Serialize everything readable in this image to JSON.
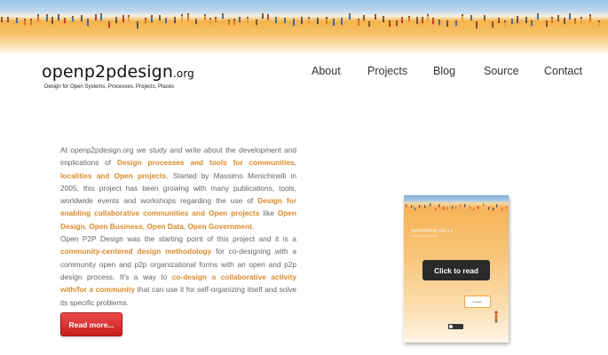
{
  "site": {
    "title": "openp2pdesign",
    "tld": ".org",
    "tagline": "Design for Open Systems, Processes, Projects, Places"
  },
  "nav": [
    {
      "label": "About"
    },
    {
      "label": "Projects"
    },
    {
      "label": "Blog"
    },
    {
      "label": "Source"
    },
    {
      "label": "Contact"
    }
  ],
  "intro": {
    "p1": [
      {
        "t": "At openp2pdesign.org we study and write about the development and implications of "
      },
      {
        "t": "Design processes and tools for communities, localities and Open projects",
        "hl": true
      },
      {
        "t": ". Started by Massimo Menichinelli in 2005, this project has been growing with many publications, tools, worldwide events and workshops regarding the use of "
      },
      {
        "t": "Design for enabling collaborative communities and Open projects",
        "hl": true
      },
      {
        "t": " like "
      },
      {
        "t": "Open Design",
        "hl": true
      },
      {
        "t": ", "
      },
      {
        "t": "Open Business",
        "hl": true
      },
      {
        "t": ", "
      },
      {
        "t": "Open Data",
        "hl": true
      },
      {
        "t": ", "
      },
      {
        "t": "Open Government",
        "hl": true
      },
      {
        "t": "."
      }
    ],
    "p2": [
      {
        "t": "Open P2P Design was the starting point of this project and it is a "
      },
      {
        "t": "community-centered design methodology",
        "hl": true
      },
      {
        "t": " for co-designing with a community open and p2p organizational forms with an open and p2p design process. It's a way to "
      },
      {
        "t": "co-design a collaborative activity with/for a community",
        "hl": true
      },
      {
        "t": " that can use it for self-organizing itself and solve its specific problems."
      }
    ]
  },
  "read_more_label": "Read more...",
  "book": {
    "title": "openp2pdesign.org_1.1",
    "subtitle": "Design for Complexity",
    "click_label": "Click to read",
    "callout_text": "A Paper"
  },
  "colors": {
    "accent": "#d98a2b",
    "button_red": "#d32a2a",
    "banner_orange": "#f5b24a",
    "banner_blue": "#9cc4e4"
  }
}
